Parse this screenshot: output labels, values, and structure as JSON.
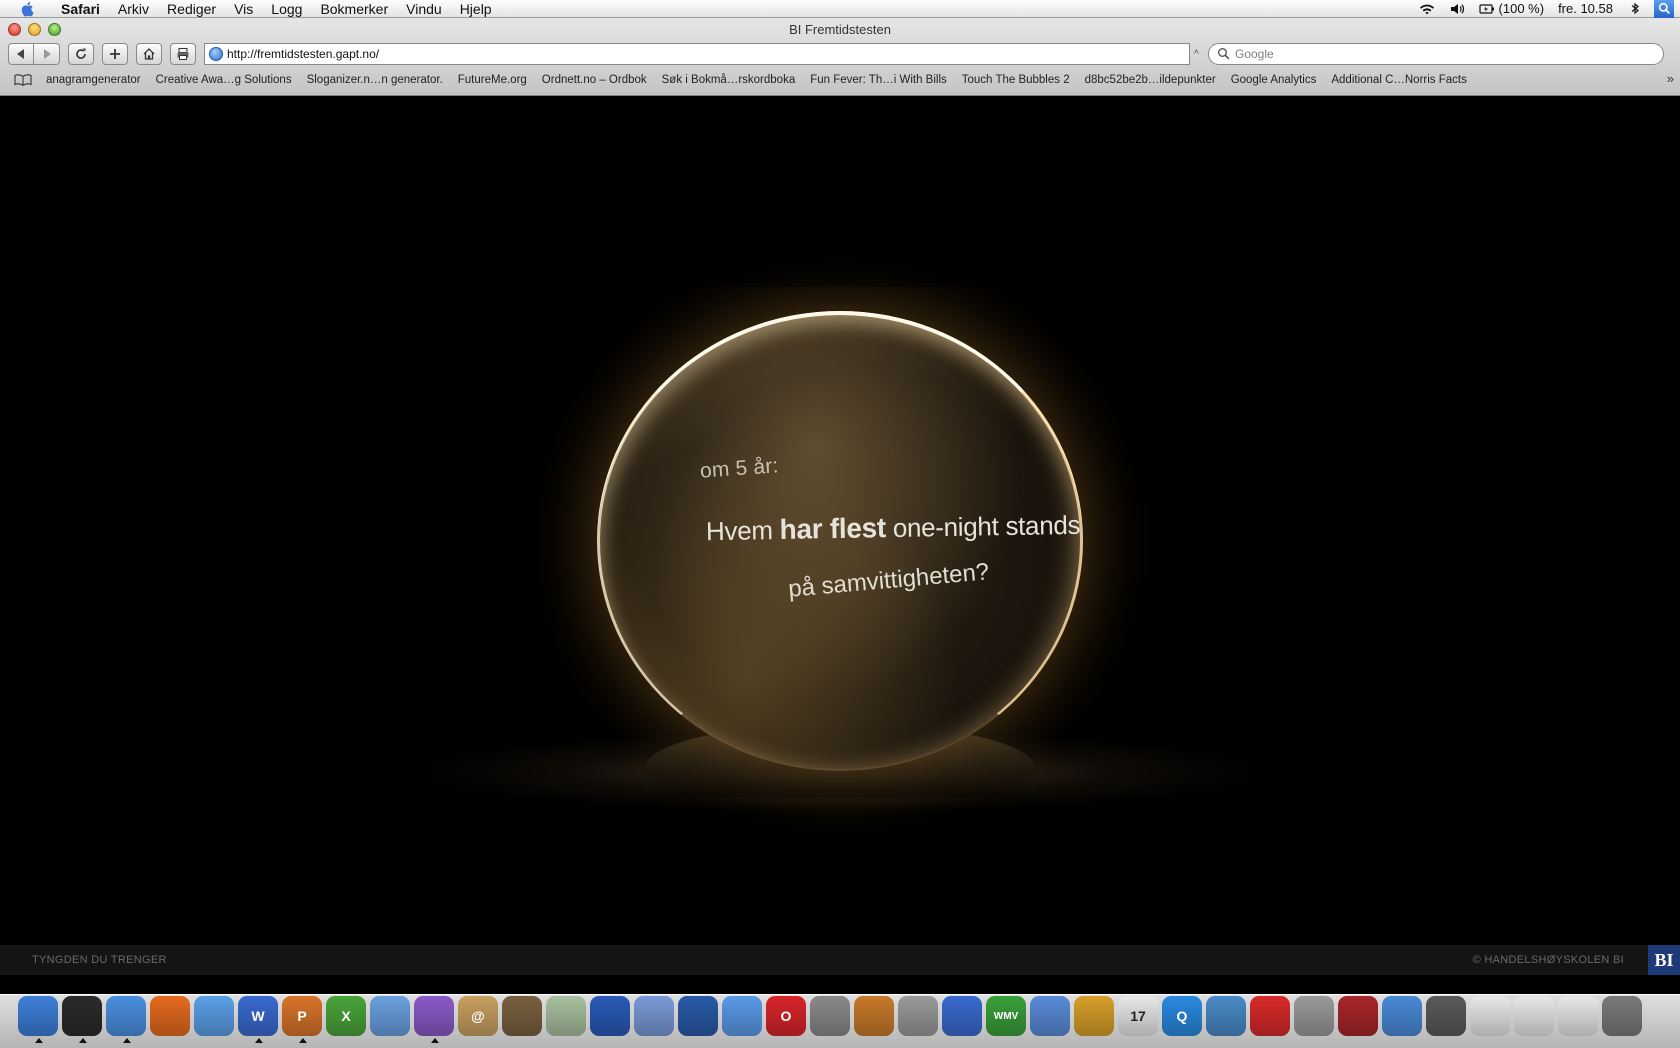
{
  "menubar": {
    "app": "Safari",
    "items": [
      "Arkiv",
      "Rediger",
      "Vis",
      "Logg",
      "Bokmerker",
      "Vindu",
      "Hjelp"
    ],
    "battery": "(100 %)",
    "clock": "fre. 10.58"
  },
  "window": {
    "title": "BI Fremtidstesten"
  },
  "toolbar": {
    "url": "http://fremtidstesten.gapt.no/",
    "search_placeholder": "Google"
  },
  "bookmarks": [
    "anagramgenerator",
    "Creative Awa…g Solutions",
    "Sloganizer.n…n generator.",
    "FutureMe.org",
    "Ordnett.no – Ordbok",
    "Søk i Bokmå…rskordboka",
    "Fun Fever: Th…i With Bills",
    "Touch The Bubbles 2",
    "d8bc52be2b…ildepunkter",
    "Google Analytics",
    "Additional C…Norris Facts"
  ],
  "page": {
    "orb_line1": "om 5 år:",
    "orb_line2_a": "Hvem ",
    "orb_line2_b": "har flest",
    "orb_line2_c": " one-night stands",
    "orb_line3": "på samvittigheten?",
    "footer_left": "TYNGDEN DU TRENGER",
    "footer_right": "© HANDELSHØYSKOLEN BI",
    "logo": "BI"
  },
  "dock": {
    "icons": [
      {
        "name": "finder-icon",
        "color": "#3d7fd8",
        "label": ""
      },
      {
        "name": "dashboard-icon",
        "color": "#2b2b2b",
        "label": ""
      },
      {
        "name": "safari-icon",
        "color": "#4a8fe0",
        "label": ""
      },
      {
        "name": "firefox-icon",
        "color": "#e66a1f",
        "label": ""
      },
      {
        "name": "ichat-icon",
        "color": "#5aa0e8",
        "label": ""
      },
      {
        "name": "word-icon",
        "color": "#3a6ad0",
        "label": "W"
      },
      {
        "name": "powerpoint-icon",
        "color": "#d8742a",
        "label": "P"
      },
      {
        "name": "excel-icon",
        "color": "#4aa43a",
        "label": "X"
      },
      {
        "name": "network-icon",
        "color": "#6aa0e0",
        "label": ""
      },
      {
        "name": "entourage-icon",
        "color": "#8a5ac8",
        "label": ""
      },
      {
        "name": "address-book-icon",
        "color": "#c8a060",
        "label": "@"
      },
      {
        "name": "iphoto-icon",
        "color": "#7a6040",
        "label": ""
      },
      {
        "name": "hand-icon",
        "color": "#a8c0a0",
        "label": ""
      },
      {
        "name": "imovie-icon",
        "color": "#2a5ab8",
        "label": ""
      },
      {
        "name": "ipod-icon",
        "color": "#7a9ad8",
        "label": ""
      },
      {
        "name": "google-earth-icon",
        "color": "#2a5aa8",
        "label": ""
      },
      {
        "name": "photo-icon",
        "color": "#5a9ae8",
        "label": ""
      },
      {
        "name": "opera-icon",
        "color": "#d8262a",
        "label": "O"
      },
      {
        "name": "sync-icon",
        "color": "#8a8a8a",
        "label": ""
      },
      {
        "name": "garageband-icon",
        "color": "#c87a2a",
        "label": ""
      },
      {
        "name": "camera-icon",
        "color": "#9a9a9a",
        "label": ""
      },
      {
        "name": "keynote-icon",
        "color": "#3a6ad0",
        "label": ""
      },
      {
        "name": "wmv-icon",
        "color": "#3aa03a",
        "label": "WMV"
      },
      {
        "name": "itunes-icon",
        "color": "#5a8ad8",
        "label": ""
      },
      {
        "name": "cocktail-icon",
        "color": "#d8a02a",
        "label": ""
      },
      {
        "name": "ical-icon",
        "color": "#e8e8e8",
        "label": "17"
      },
      {
        "name": "quicktime-icon",
        "color": "#2a8ae0",
        "label": "Q"
      },
      {
        "name": "feather-icon",
        "color": "#4a8ac8",
        "label": ""
      },
      {
        "name": "acrobat-icon",
        "color": "#d82a2a",
        "label": ""
      },
      {
        "name": "preferences-icon",
        "color": "#9a9a9a",
        "label": ""
      },
      {
        "name": "flashcard-icon",
        "color": "#a8262a",
        "label": ""
      },
      {
        "name": "messenger-icon",
        "color": "#4a8ad8",
        "label": ""
      },
      {
        "name": "printer-icon",
        "color": "#5a5a5a",
        "label": ""
      },
      {
        "name": "document-icon",
        "color": "#e8e8e8",
        "label": ""
      },
      {
        "name": "document-icon-2",
        "color": "#e8e8e8",
        "label": ""
      },
      {
        "name": "document-icon-3",
        "color": "#e8e8e8",
        "label": ""
      },
      {
        "name": "trash-icon",
        "color": "#7a7a7a",
        "label": ""
      }
    ]
  }
}
